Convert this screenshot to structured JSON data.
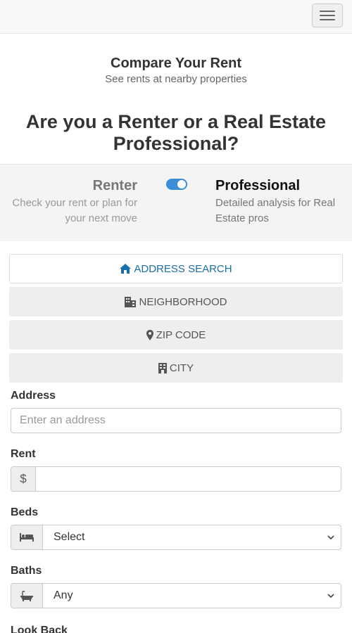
{
  "header": {
    "menu_icon": "hamburger-menu-icon",
    "title": "Compare Your Rent",
    "subtitle": "See rents at nearby properties"
  },
  "question": "Are you a Renter or a Real Estate Professional?",
  "toggle": {
    "renter_label": "Renter",
    "renter_desc": "Check your rent or plan for your next move",
    "professional_label": "Professional",
    "professional_desc": "Detailed analysis for Real Estate pros",
    "state": "professional",
    "accent": "#3b8fd9"
  },
  "search_tabs": [
    {
      "label": "ADDRESS SEARCH",
      "icon": "home-icon",
      "active": true
    },
    {
      "label": "NEIGHBORHOOD",
      "icon": "buildings-icon",
      "active": false
    },
    {
      "label": "ZIP CODE",
      "icon": "map-pin-icon",
      "active": false
    },
    {
      "label": "CITY",
      "icon": "building-icon",
      "active": false
    }
  ],
  "form": {
    "address_label": "Address",
    "address_placeholder": "Enter an address",
    "rent_label": "Rent",
    "rent_addon": "$",
    "beds_label": "Beds",
    "beds_icon": "bed-icon",
    "beds_value": "Select",
    "baths_label": "Baths",
    "baths_icon": "bathtub-icon",
    "baths_value": "Any",
    "lookback_label": "Look Back"
  }
}
